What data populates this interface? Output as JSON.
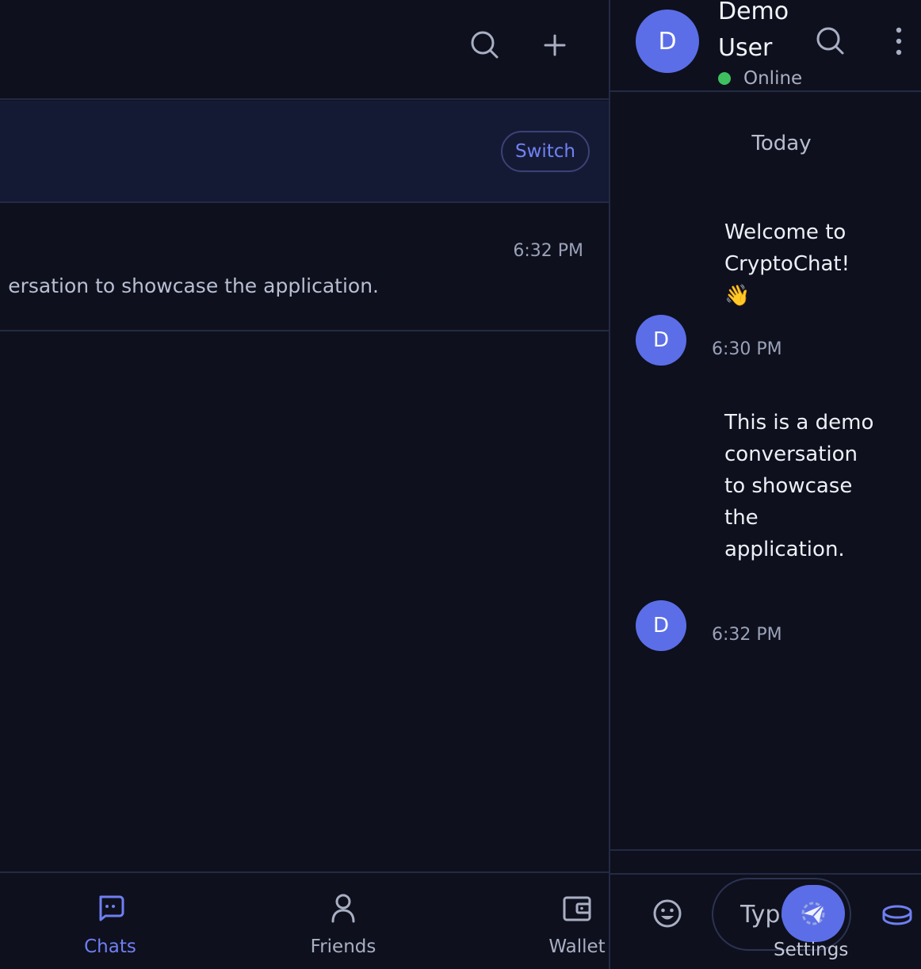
{
  "left_panel": {
    "banner": {
      "switch_label": "Switch"
    },
    "chat_list": [
      {
        "time": "6:32 PM",
        "preview": "ersation to showcase the application."
      }
    ]
  },
  "bottom_nav": {
    "tabs": [
      {
        "label": "Chats",
        "icon": "chat-icon",
        "active": true
      },
      {
        "label": "Friends",
        "icon": "person-icon",
        "active": false
      },
      {
        "label": "Wallet",
        "icon": "wallet-icon",
        "active": false
      }
    ]
  },
  "conversation": {
    "header": {
      "avatar_initial": "D",
      "name": "Demo User",
      "status": "Online"
    },
    "day_separator": "Today",
    "messages": [
      {
        "avatar_initial": "D",
        "text": "Welcome to CryptoChat! 👋",
        "time": "6:30 PM"
      },
      {
        "avatar_initial": "D",
        "text": "This is a demo conversation to showcase the application.",
        "time": "6:32 PM"
      }
    ],
    "composer": {
      "placeholder": "Type",
      "overlay_label": "Settings"
    }
  },
  "colors": {
    "background": "#0e101d",
    "banner": "#151a34",
    "accent": "#5b6ee8",
    "accent_text": "#6f7ff2",
    "online": "#3fc060",
    "border": "#232a44"
  }
}
